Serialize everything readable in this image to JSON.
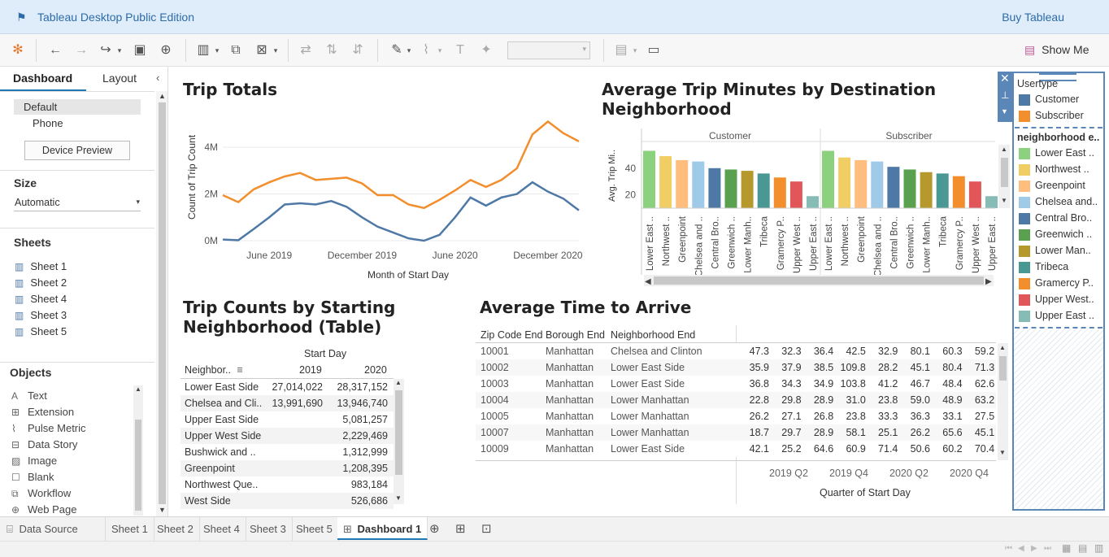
{
  "app": {
    "title": "Tableau Desktop Public Edition",
    "buy": "Buy Tableau",
    "show_me": "Show Me"
  },
  "left": {
    "tabs": [
      "Dashboard",
      "Layout"
    ],
    "devices": [
      "Default",
      "Phone"
    ],
    "device_preview": "Device Preview",
    "size_label": "Size",
    "size_value": "Automatic",
    "sheets_label": "Sheets",
    "sheets": [
      "Sheet 1",
      "Sheet 2",
      "Sheet 4",
      "Sheet 3",
      "Sheet 5"
    ],
    "objects_label": "Objects",
    "objects": [
      "Text",
      "Extension",
      "Pulse Metric",
      "Data Story",
      "Image",
      "Blank",
      "Workflow",
      "Web Page"
    ]
  },
  "tabs": {
    "data_source": "Data Source",
    "sheets": [
      "Sheet 1",
      "Sheet 2",
      "Sheet 4",
      "Sheet 3",
      "Sheet 5"
    ],
    "active": "Dashboard 1"
  },
  "colors": {
    "orange": "#f28e2b",
    "blue": "#4e79a7"
  },
  "trip_totals": {
    "title": "Trip Totals",
    "ylabel": "Count of Trip Count",
    "xlabel": "Month of Start Day",
    "yticks": [
      "4M",
      "2M",
      "0M"
    ],
    "xticks": [
      "June 2019",
      "December 2019",
      "June 2020",
      "December 2020"
    ]
  },
  "avg_minutes": {
    "title1": "Average Trip Minutes by Destination",
    "title2": "Neighborhood",
    "panels": [
      "Customer",
      "Subscriber"
    ],
    "ylabel": "Avg. Trip Mi..",
    "yticks": [
      "40",
      "20"
    ],
    "cats": [
      "Lower East ..",
      "Northwest ..",
      "Greenpoint",
      "Chelsea and ..",
      "Central Bro..",
      "Greenwich ..",
      "Lower Manh..",
      "Tribeca",
      "Gramercy P..",
      "Upper West ..",
      "Upper East .."
    ]
  },
  "trip_counts": {
    "title1": "Trip Counts by Starting",
    "title2": "Neighborhood (Table)",
    "col_header": "Start Day",
    "row_header": "Neighbor..",
    "years": [
      "2019",
      "2020"
    ],
    "rows": [
      {
        "name": "Lower East Side",
        "y2019": "27,014,022",
        "y2020": "28,317,152"
      },
      {
        "name": "Chelsea and Cli..",
        "y2019": "13,991,690",
        "y2020": "13,946,740"
      },
      {
        "name": "Upper East Side",
        "y2019": "",
        "y2020": "5,081,257"
      },
      {
        "name": "Upper West Side",
        "y2019": "",
        "y2020": "2,229,469"
      },
      {
        "name": "Bushwick and ..",
        "y2019": "",
        "y2020": "1,312,999"
      },
      {
        "name": "Greenpoint",
        "y2019": "",
        "y2020": "1,208,395"
      },
      {
        "name": "Northwest Que..",
        "y2019": "",
        "y2020": "983,184"
      },
      {
        "name": "West Side",
        "y2019": "",
        "y2020": "526,686"
      }
    ]
  },
  "avg_time": {
    "title": "Average Time to Arrive",
    "headers": [
      "Zip Code End",
      "Borough End",
      "Neighborhood End"
    ],
    "rows": [
      {
        "zip": "10001",
        "boro": "Manhattan",
        "nb": "Chelsea and Clinton",
        "v": [
          "47.3",
          "32.3",
          "36.4",
          "42.5",
          "32.9",
          "80.1",
          "60.3",
          "59.2"
        ]
      },
      {
        "zip": "10002",
        "boro": "Manhattan",
        "nb": "Lower East Side",
        "v": [
          "35.9",
          "37.9",
          "38.5",
          "109.8",
          "28.2",
          "45.1",
          "80.4",
          "71.3"
        ]
      },
      {
        "zip": "10003",
        "boro": "Manhattan",
        "nb": "Lower East Side",
        "v": [
          "36.8",
          "34.3",
          "34.9",
          "103.8",
          "41.2",
          "46.7",
          "48.4",
          "62.6"
        ]
      },
      {
        "zip": "10004",
        "boro": "Manhattan",
        "nb": "Lower Manhattan",
        "v": [
          "22.8",
          "29.8",
          "28.9",
          "31.0",
          "23.8",
          "59.0",
          "48.9",
          "63.2"
        ]
      },
      {
        "zip": "10005",
        "boro": "Manhattan",
        "nb": "Lower Manhattan",
        "v": [
          "26.2",
          "27.1",
          "26.8",
          "23.8",
          "33.3",
          "36.3",
          "33.1",
          "27.5"
        ]
      },
      {
        "zip": "10007",
        "boro": "Manhattan",
        "nb": "Lower Manhattan",
        "v": [
          "18.7",
          "29.7",
          "28.9",
          "58.1",
          "25.1",
          "26.2",
          "65.6",
          "45.1"
        ]
      },
      {
        "zip": "10009",
        "boro": "Manhattan",
        "nb": "Lower East Side",
        "v": [
          "42.1",
          "25.2",
          "64.6",
          "60.9",
          "71.4",
          "50.6",
          "60.2",
          "70.4"
        ]
      }
    ],
    "quarters": [
      "2019 Q2",
      "2019 Q4",
      "2020 Q2",
      "2020 Q4"
    ],
    "xlabel": "Quarter of Start Day"
  },
  "legend": {
    "usertype_title": "Usertype",
    "usertypes": [
      {
        "label": "Customer",
        "color": "#4e79a7"
      },
      {
        "label": "Subscriber",
        "color": "#f28e2b"
      }
    ],
    "nb_title": "neighborhood e..",
    "nbs": [
      {
        "label": "Lower East ..",
        "color": "#8cd17d"
      },
      {
        "label": "Northwest ..",
        "color": "#f1ce63"
      },
      {
        "label": "Greenpoint",
        "color": "#ffbe7d"
      },
      {
        "label": "Chelsea and..",
        "color": "#a0cbe8"
      },
      {
        "label": "Central Bro..",
        "color": "#4e79a7"
      },
      {
        "label": "Greenwich ..",
        "color": "#59a14f"
      },
      {
        "label": "Lower Man..",
        "color": "#b6992d"
      },
      {
        "label": "Tribeca",
        "color": "#499894"
      },
      {
        "label": "Gramercy P..",
        "color": "#f28e2b"
      },
      {
        "label": "Upper West..",
        "color": "#e15759"
      },
      {
        "label": "Upper East ..",
        "color": "#86bcb6"
      }
    ]
  },
  "chart_data": [
    {
      "type": "line",
      "title": "Trip Totals",
      "xlabel": "Month of Start Day",
      "ylabel": "Count of Trip Count",
      "x": [
        "2019-03",
        "2019-04",
        "2019-05",
        "2019-06",
        "2019-07",
        "2019-08",
        "2019-09",
        "2019-10",
        "2019-11",
        "2019-12",
        "2020-01",
        "2020-02",
        "2020-03",
        "2020-04",
        "2020-05",
        "2020-06",
        "2020-07",
        "2020-08",
        "2020-09",
        "2020-10",
        "2020-11",
        "2020-12",
        "2021-01",
        "2021-02"
      ],
      "series": [
        {
          "name": "Subscriber",
          "values": [
            1.95,
            1.65,
            2.2,
            2.5,
            2.75,
            2.9,
            2.6,
            2.65,
            2.7,
            2.45,
            1.95,
            1.95,
            1.55,
            1.4,
            1.75,
            2.15,
            2.6,
            2.3,
            2.6,
            3.1,
            4.55,
            5.1,
            4.6,
            4.25
          ]
        },
        {
          "name": "Customer",
          "values": [
            0.05,
            0.02,
            0.5,
            1.0,
            1.55,
            1.6,
            1.55,
            1.7,
            1.45,
            1.0,
            0.6,
            0.35,
            0.1,
            0.0,
            0.25,
            1.0,
            1.85,
            1.5,
            1.85,
            2.0,
            2.5,
            2.1,
            1.8,
            1.3
          ]
        }
      ],
      "ylim": [
        0,
        5.5
      ]
    },
    {
      "type": "bar",
      "title": "Average Trip Minutes by Destination Neighborhood",
      "ylabel": "Avg. Trip Mi..",
      "categories": [
        "Lower East ..",
        "Northwest ..",
        "Greenpoint",
        "Chelsea and ..",
        "Central Bro..",
        "Greenwich ..",
        "Lower Manh..",
        "Tribeca",
        "Gramercy P..",
        "Upper West ..",
        "Upper East .."
      ],
      "series": [
        {
          "name": "Customer",
          "values": [
            53,
            49,
            46,
            45,
            40,
            39,
            38,
            36,
            33,
            30,
            19
          ]
        },
        {
          "name": "Subscriber",
          "values": [
            53,
            48,
            46,
            45,
            41,
            39,
            37,
            36,
            34,
            30,
            19
          ]
        }
      ],
      "ylim": [
        10,
        60
      ]
    }
  ]
}
